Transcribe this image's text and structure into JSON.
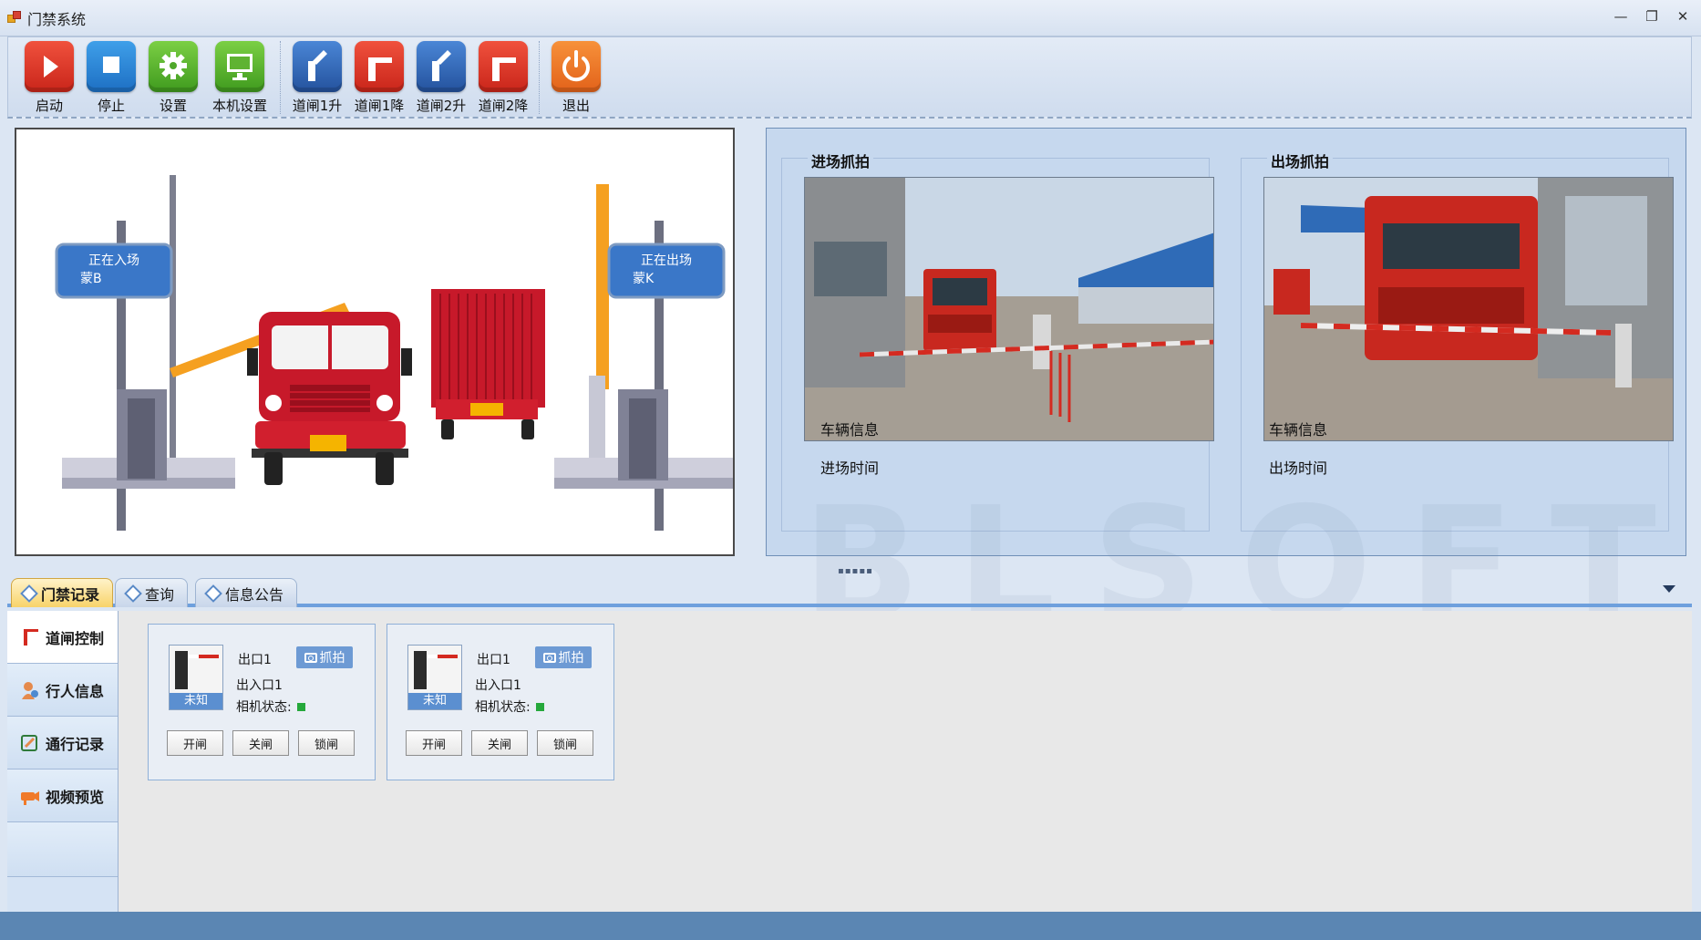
{
  "window": {
    "title": "门禁系统"
  },
  "toolbar": {
    "buttons": [
      {
        "label": "启动",
        "icon": "play-icon"
      },
      {
        "label": "停止",
        "icon": "stop-icon"
      },
      {
        "label": "设置",
        "icon": "gear-icon"
      },
      {
        "label": "本机设置",
        "icon": "monitor-icon"
      },
      {
        "label": "道闸1升",
        "icon": "barrier-up-icon"
      },
      {
        "label": "道闸1降",
        "icon": "barrier-down-icon"
      },
      {
        "label": "道闸2升",
        "icon": "barrier-up-icon"
      },
      {
        "label": "道闸2降",
        "icon": "barrier-down-icon"
      },
      {
        "label": "退出",
        "icon": "power-icon"
      }
    ]
  },
  "scene": {
    "entry_sign": {
      "line1": "正在入场",
      "line2": "蒙B"
    },
    "exit_sign": {
      "line1": "正在出场",
      "line2": "蒙K"
    }
  },
  "capture": {
    "entry": {
      "title": "进场抓拍",
      "info_label": "车辆信息",
      "time_label": "进场时间"
    },
    "exit": {
      "title": "出场抓拍",
      "info_label": "车辆信息",
      "time_label": "出场时间"
    }
  },
  "watermark": "BLSOFT",
  "tabs": [
    {
      "label": "门禁记录",
      "active": true
    },
    {
      "label": "查询",
      "active": false
    },
    {
      "label": "信息公告",
      "active": false
    }
  ],
  "sidenav": [
    {
      "label": "道闸控制",
      "icon": "barrier-icon",
      "active": true
    },
    {
      "label": "行人信息",
      "icon": "person-icon",
      "active": false
    },
    {
      "label": "通行记录",
      "icon": "edit-icon",
      "active": false
    },
    {
      "label": "视频预览",
      "icon": "camera-icon",
      "active": false
    }
  ],
  "gates": [
    {
      "name": "出口1",
      "direction": "出入口1",
      "camera_label": "相机状态:",
      "status": "未知",
      "snap_label": "抓拍",
      "open_label": "开闸",
      "close_label": "关闸",
      "lock_label": "锁闸"
    },
    {
      "name": "出口1",
      "direction": "出入口1",
      "camera_label": "相机状态:",
      "status": "未知",
      "snap_label": "抓拍",
      "open_label": "开闸",
      "close_label": "关闸",
      "lock_label": "锁闸"
    }
  ],
  "colors": {
    "accent": "#6ea0dd",
    "camera_ok": "#25a83b",
    "statusbar": "#5b86b3"
  }
}
